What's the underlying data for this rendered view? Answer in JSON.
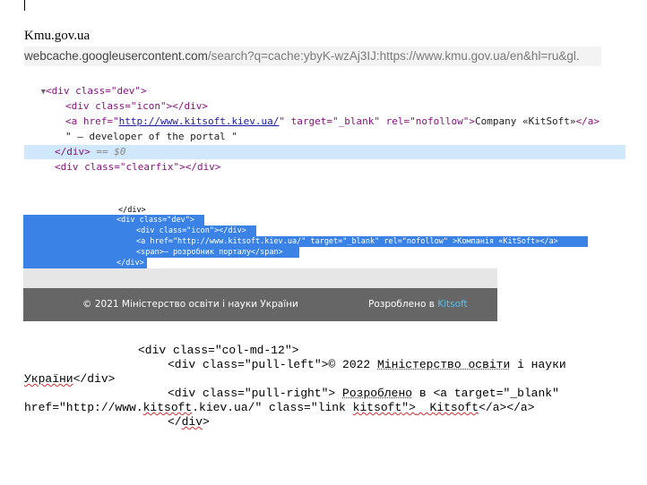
{
  "doc": {
    "title": "Kmu.gov.ua"
  },
  "url": {
    "host": "webcache.googleusercontent.com",
    "path": "/search?q=cache:ybyK-wzAj3IJ:https://www.kmu.gov.ua/en&hl=ru&gl."
  },
  "devtools": {
    "l1_tag": "<div class=\"dev\">",
    "l2_tag": "<div class=\"icon\"></div>",
    "l3_open": "<a href=\"",
    "l3_href": "http://www.kitsoft.kiev.ua/",
    "l3_rest": "\" target=\"_blank\" rel=\"nofollow\">",
    "l3_text": "Company «KitSoft»",
    "l3_close": "</a>",
    "l4_text": "\" — developer of the portal \"",
    "l5_tag": "</div>",
    "l5_eq": "== $0",
    "l6_tag": "<div class=\"clearfix\"></div>"
  },
  "source": {
    "s0": "</div>",
    "s1": "<div class=\"dev\">",
    "s2": "<div class=\"icon\"></div>",
    "s3": "<a href=\"http://www.kitsoft.kiev.ua/\" target=\"_blank\" rel=\"nofollow\" >Компанія  «KitSoft»</a>",
    "s4": "<span>—  розробник порталу</span>",
    "s5": "</div>"
  },
  "footer": {
    "copyright": "© 2021 Міністерство освіти і науки України",
    "developed_by": "Розроблено в ",
    "brand": "Kitsoft"
  },
  "code": {
    "c1": "<div class=\"col-md-12\">",
    "c2a": "<div class=\"pull-left\">© 2022 ",
    "c2b": "Міністерство освіти",
    "c2c": " і науки",
    "c3a": "України",
    "c3b": "</div>",
    "c4a": "<div class=\"pull-right\"> ",
    "c4b": "Розроблено",
    "c4c": " в <a target=\"_blank\"",
    "c5a": "href=\"http://www.",
    "c5b": "kitsoft",
    "c5c": ".kiev.ua/\" class=\"link ",
    "c5d": "kitsoft",
    "c5e": "\">",
    "c5f": "  Kitsoft",
    "c5g": "</a></a>",
    "c6a": "</",
    "c6b": "div",
    "c6c": ">"
  }
}
